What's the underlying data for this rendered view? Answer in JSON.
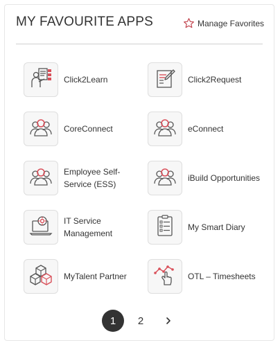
{
  "header": {
    "title": "MY FAVOURITE APPS",
    "manage_label": "Manage Favorites",
    "manage_icon": "star-outline-icon"
  },
  "apps": [
    {
      "label": "Click2Learn",
      "icon": "learning-icon"
    },
    {
      "label": "Click2Request",
      "icon": "form-request-icon"
    },
    {
      "label": "CoreConnect",
      "icon": "people-group-icon"
    },
    {
      "label": "eConnect",
      "icon": "people-group-icon"
    },
    {
      "label": "Employee Self-Service (ESS)",
      "icon": "people-group-icon"
    },
    {
      "label": "iBuild Opportunities",
      "icon": "people-group-icon"
    },
    {
      "label": "IT Service Management",
      "icon": "laptop-support-icon"
    },
    {
      "label": "My Smart Diary",
      "icon": "checklist-icon"
    },
    {
      "label": "MyTalent Partner",
      "icon": "cubes-icon"
    },
    {
      "label": "OTL – Timesheets",
      "icon": "chart-touch-icon"
    }
  ],
  "pagination": {
    "pages": [
      "1",
      "2"
    ],
    "current": "1",
    "next_icon": "chevron-right-icon"
  },
  "colors": {
    "accent": "#d9505a",
    "icon_gray": "#555555",
    "active_page": "#333333"
  }
}
